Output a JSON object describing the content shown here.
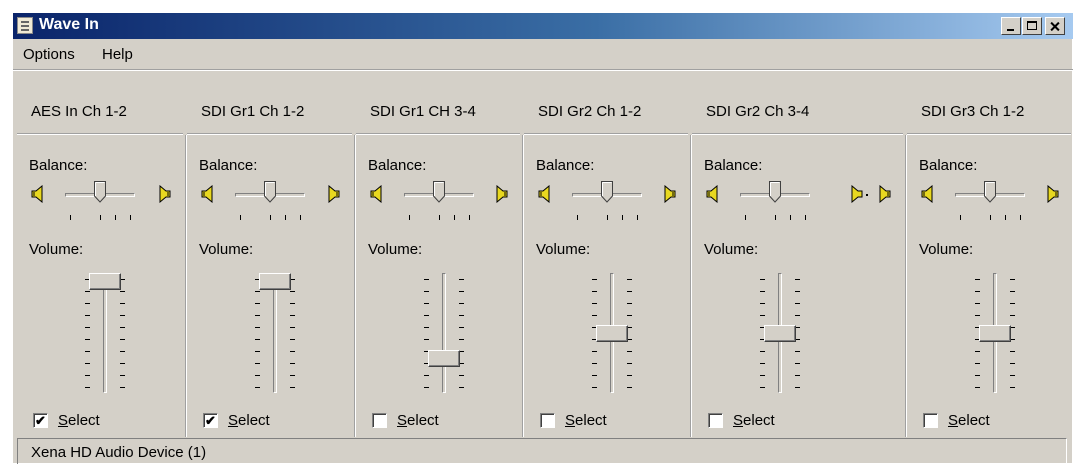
{
  "window": {
    "title": "Wave In"
  },
  "menu": [
    "Options",
    "Help"
  ],
  "common": {
    "balance_label": "Balance:",
    "volume_label": "Volume:",
    "select_mnemonic": "S",
    "select_rest": "elect"
  },
  "channels": [
    {
      "name": "AES In Ch 1-2",
      "balance": 0.5,
      "volume": 1.0,
      "selected": true
    },
    {
      "name": "SDI Gr1 Ch 1-2",
      "balance": 0.5,
      "volume": 1.0,
      "selected": true
    },
    {
      "name": "SDI Gr1 CH 3-4",
      "balance": 0.5,
      "volume": 0.25,
      "selected": false
    },
    {
      "name": "SDI Gr2 Ch 1-2",
      "balance": 0.5,
      "volume": 0.5,
      "selected": false
    },
    {
      "name": "SDI Gr2 Ch 3-4",
      "balance": 0.5,
      "volume": 0.5,
      "selected": false
    },
    {
      "name": "SDI Gr3 Ch 1-2",
      "balance": 0.5,
      "volume": 0.5,
      "selected": false
    }
  ],
  "status": {
    "text": "Xena HD Audio Device (1)"
  },
  "colors": {
    "title_bar_start": "#0a246a",
    "title_bar_end": "#a6caf0",
    "face": "#d4d0c8",
    "speaker": "#e8d820"
  }
}
